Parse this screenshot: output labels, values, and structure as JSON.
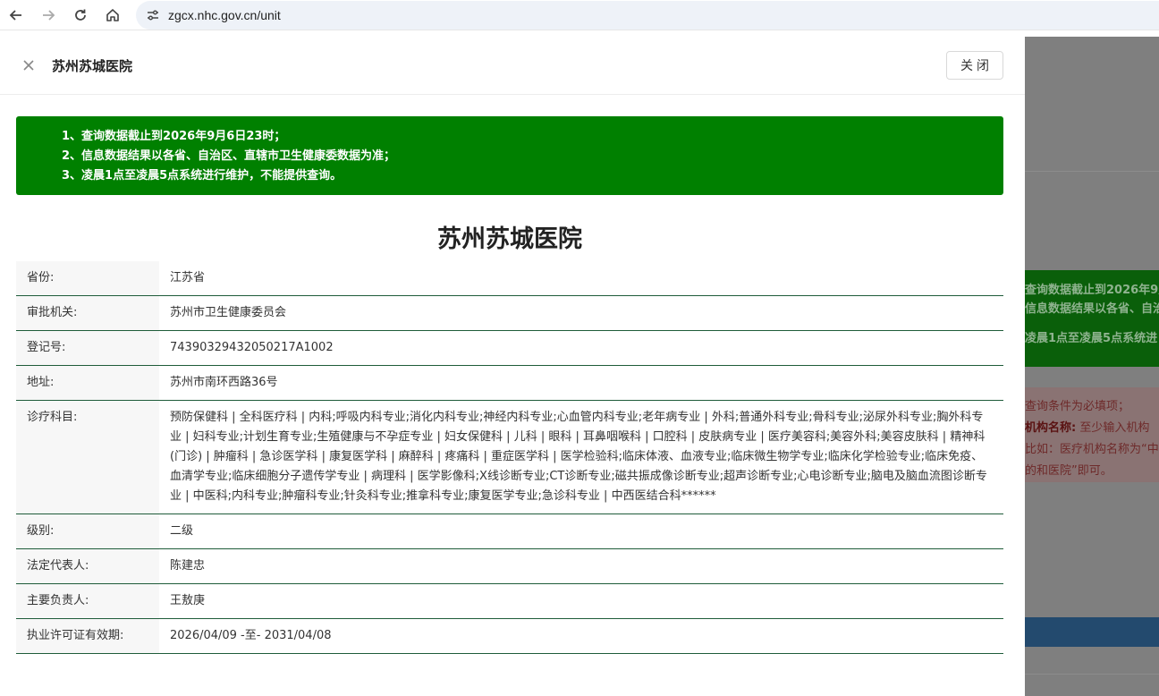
{
  "browser": {
    "url": "zgcx.nhc.gov.cn/unit",
    "icons": [
      "back-icon",
      "forward-icon",
      "reload-icon",
      "home-icon",
      "site-settings-icon"
    ]
  },
  "drawer": {
    "title": "苏州苏城医院",
    "close_label": "关闭"
  },
  "notice": {
    "lines": [
      "1、查询数据截止到2026年9月6日23时；",
      "2、信息数据结果以各省、自治区、直辖市卫生健康委数据为准；",
      "3、凌晨1点至凌晨5点系统进行维护，不能提供查询。"
    ],
    "color": "#008000"
  },
  "hospital": {
    "name": "苏州苏城医院",
    "fields": [
      {
        "label": "省份:",
        "value": "江苏省"
      },
      {
        "label": "审批机关:",
        "value": "苏州市卫生健康委员会"
      },
      {
        "label": "登记号:",
        "value": "74390329432050217A1002"
      },
      {
        "label": "地址:",
        "value": "苏州市南环西路36号"
      },
      {
        "label": "诊疗科目:",
        "value": "预防保健科 | 全科医疗科 | 内科;呼吸内科专业;消化内科专业;神经内科专业;心血管内科专业;老年病专业 | 外科;普通外科专业;骨科专业;泌尿外科专业;胸外科专业 | 妇科专业;计划生育专业;生殖健康与不孕症专业 | 妇女保健科 | 儿科 | 眼科 | 耳鼻咽喉科 | 口腔科 | 皮肤病专业 | 医疗美容科;美容外科;美容皮肤科 | 精神科(门诊) | 肿瘤科 | 急诊医学科 | 康复医学科 | 麻醉科 | 疼痛科 | 重症医学科 | 医学检验科;临床体液、血液专业;临床微生物学专业;临床化学检验专业;临床免疫、血清学专业;临床细胞分子遗传学专业 | 病理科 | 医学影像科;X线诊断专业;CT诊断专业;磁共振成像诊断专业;超声诊断专业;心电诊断专业;脑电及脑血流图诊断专业 | 中医科;内科专业;肿瘤科专业;针灸科专业;推拿科专业;康复医学专业;急诊科专业 | 中西医结合科******"
      },
      {
        "label": "级别:",
        "value": "二级"
      },
      {
        "label": "法定代表人:",
        "value": "陈建忠"
      },
      {
        "label": "主要负责人:",
        "value": "王敖庚"
      },
      {
        "label": "执业许可证有效期:",
        "value": "2026/04/09 -至- 2031/04/08"
      }
    ]
  },
  "background_page": {
    "green_lines": [
      "查询数据截止到2026年9月",
      "信息数据结果以各省、自治",
      "凌晨1点至凌晨5点系统进"
    ],
    "pink_line1": "查询条件为必填项；",
    "pink_line2_bold": "机构名称:",
    "pink_line2_rest": " 至少输入机构",
    "pink_line3": "比如：医疗机构名称为“中",
    "pink_line4": "的和医院”即可。"
  }
}
